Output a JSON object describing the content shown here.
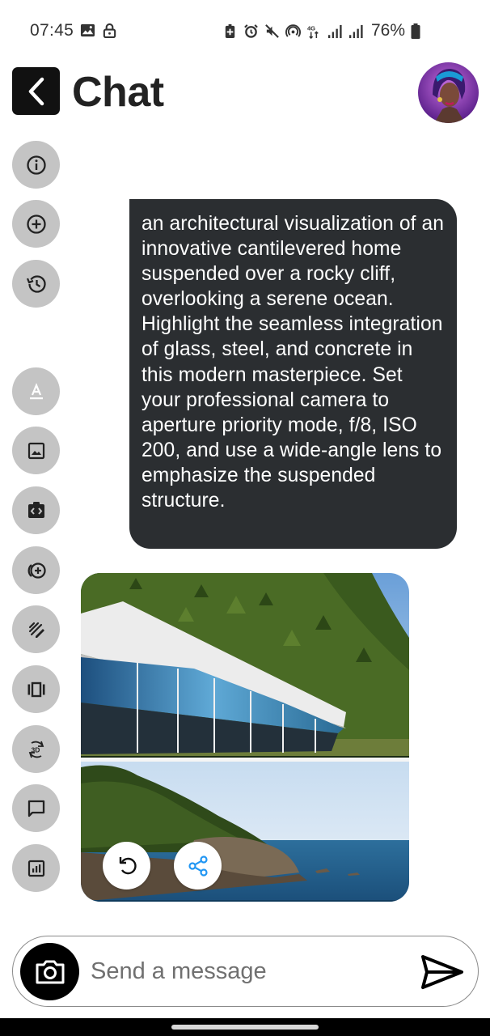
{
  "status_bar": {
    "time": "07:45",
    "battery_percent": "76%",
    "network_label": "4G",
    "icons": [
      "image-icon",
      "lock-icon",
      "battery-saver-icon",
      "alarm-icon",
      "mute-icon",
      "hotspot-icon",
      "network-4g-icon",
      "signal-icon",
      "signal-icon",
      "battery-icon"
    ]
  },
  "header": {
    "title": "Chat",
    "back_icon": "chevron-left-icon",
    "avatar": "assistant-avatar"
  },
  "toolbar": {
    "items": [
      {
        "name": "info",
        "icon": "info-icon"
      },
      {
        "name": "new-chat",
        "icon": "plus-circle-icon"
      },
      {
        "name": "history",
        "icon": "history-icon"
      },
      {
        "name": "text-style",
        "icon": "text-format-icon"
      },
      {
        "name": "image",
        "icon": "image-icon"
      },
      {
        "name": "code",
        "icon": "code-icon"
      },
      {
        "name": "add-credits",
        "icon": "add-circle-double-icon"
      },
      {
        "name": "draw",
        "icon": "draw-icon"
      },
      {
        "name": "carousel",
        "icon": "carousel-icon"
      },
      {
        "name": "3d",
        "icon": "3d-rotation-icon",
        "label": "3D"
      },
      {
        "name": "comment",
        "icon": "comment-icon"
      },
      {
        "name": "analytics",
        "icon": "analytics-icon"
      }
    ]
  },
  "message": {
    "text": "an architectural visualization of an innovative cantilevered home suspended over a rocky cliff, overlooking a serene ocean. Highlight the seamless integration of glass, steel, and concrete in this modern masterpiece. Set your professional camera to aperture priority mode, f/8, ISO 200, and use a wide-angle lens to emphasize the suspended structure.",
    "bubble_color": "#2b2e31"
  },
  "generated_image": {
    "actions": [
      {
        "name": "regenerate",
        "icon": "refresh-icon"
      },
      {
        "name": "share",
        "icon": "share-icon"
      }
    ]
  },
  "composer": {
    "placeholder": "Send a message",
    "value": "",
    "camera_icon": "camera-icon",
    "send_icon": "send-icon"
  }
}
